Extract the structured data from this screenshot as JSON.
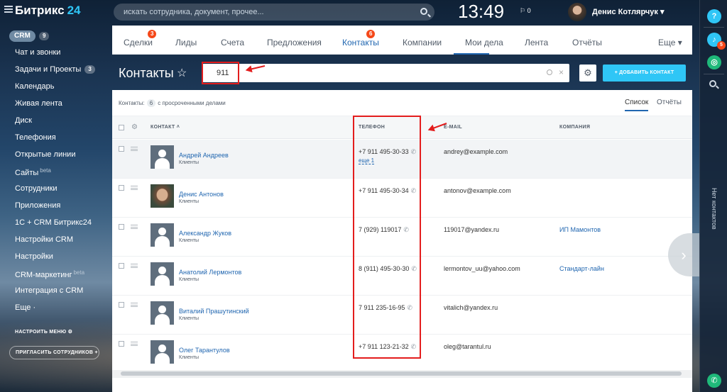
{
  "header": {
    "logo_main": "Битрикс",
    "logo_num": "24",
    "search_placeholder": "искать сотрудника, документ, прочее...",
    "clock": "13:49",
    "flag_count": "0",
    "user_name": "Денис Котлярчук"
  },
  "sidebar": {
    "crm_label": "CRM",
    "crm_count": "9",
    "items": [
      {
        "label": "Чат и звонки",
        "badge": "",
        "sup": ""
      },
      {
        "label": "Задачи и Проекты",
        "badge": "3",
        "sup": ""
      },
      {
        "label": "Календарь",
        "badge": "",
        "sup": ""
      },
      {
        "label": "Живая лента",
        "badge": "",
        "sup": ""
      },
      {
        "label": "Диск",
        "badge": "",
        "sup": ""
      },
      {
        "label": "Телефония",
        "badge": "",
        "sup": ""
      },
      {
        "label": "Открытые линии",
        "badge": "",
        "sup": ""
      },
      {
        "label": "Сайты",
        "badge": "",
        "sup": "beta"
      },
      {
        "label": "Сотрудники",
        "badge": "",
        "sup": ""
      },
      {
        "label": "Приложения",
        "badge": "",
        "sup": ""
      },
      {
        "label": "1С + CRM Битрикс24",
        "badge": "",
        "sup": ""
      },
      {
        "label": "Настройки CRM",
        "badge": "",
        "sup": ""
      },
      {
        "label": "Настройки",
        "badge": "",
        "sup": ""
      },
      {
        "label": "CRM-маркетинг",
        "badge": "",
        "sup": "beta"
      },
      {
        "label": "Интеграция с CRM",
        "badge": "",
        "sup": ""
      },
      {
        "label": "Еще ·",
        "badge": "",
        "sup": ""
      }
    ],
    "configure_menu": "НАСТРОИТЬ МЕНЮ",
    "invite": "ПРИГЛАСИТЬ СОТРУДНИКОВ"
  },
  "tabs": [
    {
      "label": "Сделки",
      "badge": "3"
    },
    {
      "label": "Лиды",
      "badge": ""
    },
    {
      "label": "Счета",
      "badge": ""
    },
    {
      "label": "Предложения",
      "badge": ""
    },
    {
      "label": "Контакты",
      "badge": "6"
    },
    {
      "label": "Компании",
      "badge": ""
    },
    {
      "label": "Мои дела",
      "badge": ""
    },
    {
      "label": "Лента",
      "badge": ""
    },
    {
      "label": "Отчёты",
      "badge": ""
    },
    {
      "label": "Еще ▾",
      "badge": ""
    }
  ],
  "page": {
    "title": "Контакты",
    "filter_value": "911",
    "add_button": "ДОБАВИТЬ КОНТАКТ",
    "summary_prefix": "Контакты:",
    "summary_count": "6",
    "summary_suffix": "с просроченными делами",
    "view_list": "Список",
    "view_reports": "Отчёты"
  },
  "table": {
    "columns": [
      "КОНТАКТ",
      "ТЕЛЕФОН",
      "E-MAIL",
      "КОМПАНИЯ"
    ],
    "rows": [
      {
        "name": "Андрей Андреев",
        "type": "Клиенты",
        "phone": "+7 911 495-30-33",
        "more": "еще 1",
        "email": "andrey@example.com",
        "company": ""
      },
      {
        "name": "Денис Антонов",
        "type": "Клиенты",
        "phone": "+7 911 495-30-34",
        "more": "",
        "email": "antonov@example.com",
        "company": ""
      },
      {
        "name": "Александр Жуков",
        "type": "Клиенты",
        "phone": "7 (929) 119017",
        "more": "",
        "email": "119017@yandex.ru",
        "company": "ИП Мамонтов"
      },
      {
        "name": "Анатолий Лермонтов",
        "type": "Клиенты",
        "phone": "8 (911) 495-30-30",
        "more": "",
        "email": "lermontov_uu@yahoo.com",
        "company": "Стандарт-лайн"
      },
      {
        "name": "Виталий Прашутинский",
        "type": "Клиенты",
        "phone": "7 911 235-16-95",
        "more": "",
        "email": "vitalich@yandex.ru",
        "company": ""
      },
      {
        "name": "Олег Тарантулов",
        "type": "Клиенты",
        "phone": "+7 911 123-21-32",
        "more": "",
        "email": "oleg@tarantul.ru",
        "company": ""
      }
    ]
  },
  "rightbar": {
    "help": "?",
    "notify_badge": "5",
    "vertical_label": "Нет контактов"
  },
  "colors": {
    "accent": "#2fc6f6",
    "link": "#2066b0",
    "badge": "#f54819",
    "annotation": "#e31d1d"
  }
}
